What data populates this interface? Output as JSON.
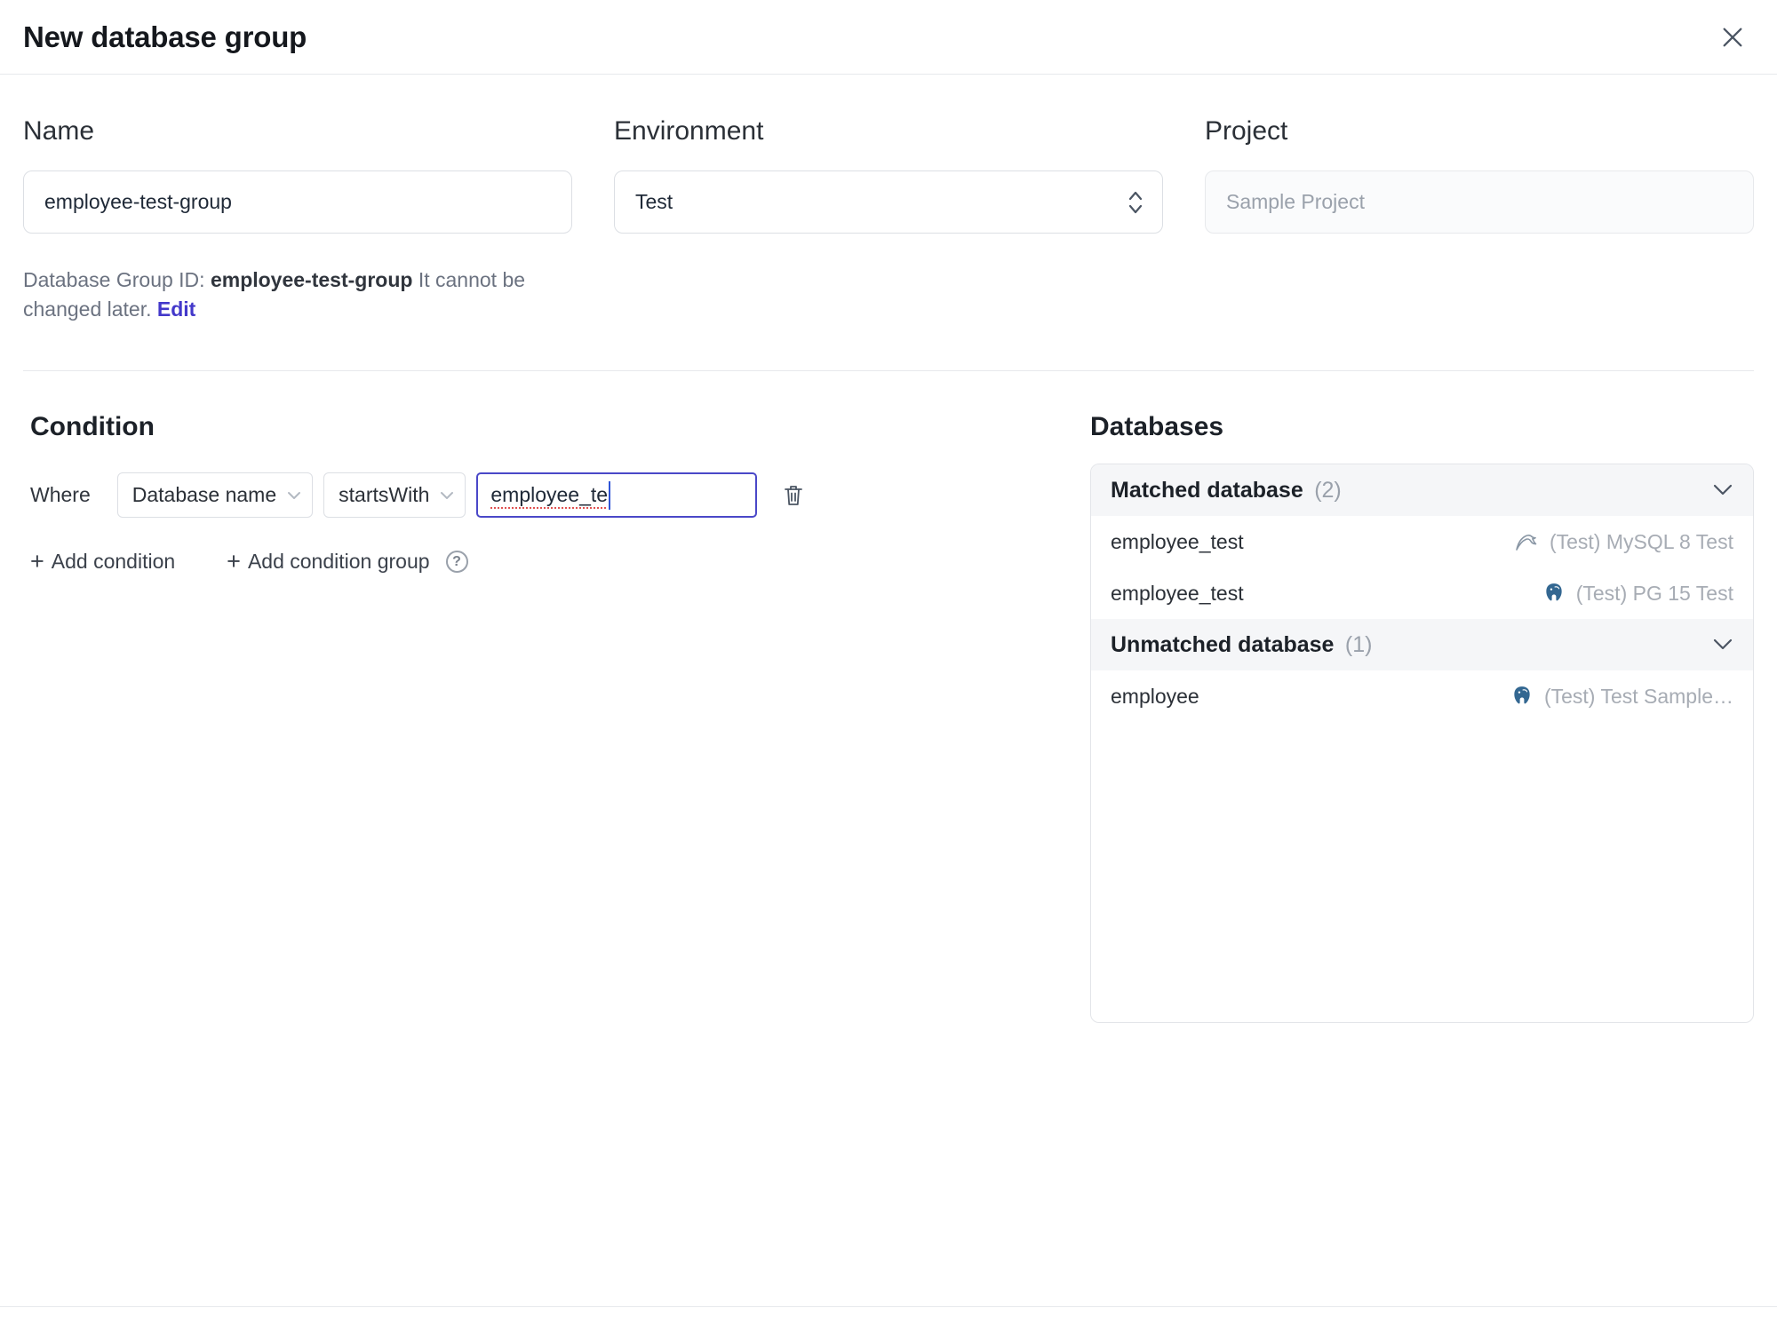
{
  "header": {
    "title": "New database group"
  },
  "icons": {
    "plus": "+",
    "help": "?"
  },
  "form": {
    "name": {
      "label": "Name",
      "value": "employee-test-group"
    },
    "environment": {
      "label": "Environment",
      "value": "Test"
    },
    "project": {
      "label": "Project",
      "value": "Sample Project"
    },
    "note": {
      "prefix": "Database Group ID:",
      "group_id": "employee-test-group",
      "middle": "It cannot be changed later.",
      "edit": "Edit"
    }
  },
  "condition": {
    "title": "Condition",
    "where": "Where",
    "field": "Database name",
    "operator": "startsWith",
    "value": "employee_te",
    "add_condition": "Add condition",
    "add_condition_group": "Add condition group"
  },
  "databases": {
    "title": "Databases",
    "groups": [
      {
        "label": "Matched database",
        "count": "(2)",
        "rows": [
          {
            "name": "employee_test",
            "engine": "mysql",
            "instance": "(Test) MySQL 8 Test"
          },
          {
            "name": "employee_test",
            "engine": "postgres",
            "instance": "(Test) PG 15 Test"
          }
        ]
      },
      {
        "label": "Unmatched database",
        "count": "(1)",
        "rows": [
          {
            "name": "employee",
            "engine": "postgres",
            "instance": "(Test) Test Sample…"
          }
        ]
      }
    ]
  },
  "colors": {
    "accent": "#4338ca",
    "focus_border": "#4a48c8",
    "border": "#e7e9ec",
    "text": "#1f2937",
    "muted": "#9aa1ab",
    "panel_header_bg": "#f5f6f8",
    "postgres_blue": "#336791",
    "spellcheck_red": "#e05252"
  }
}
